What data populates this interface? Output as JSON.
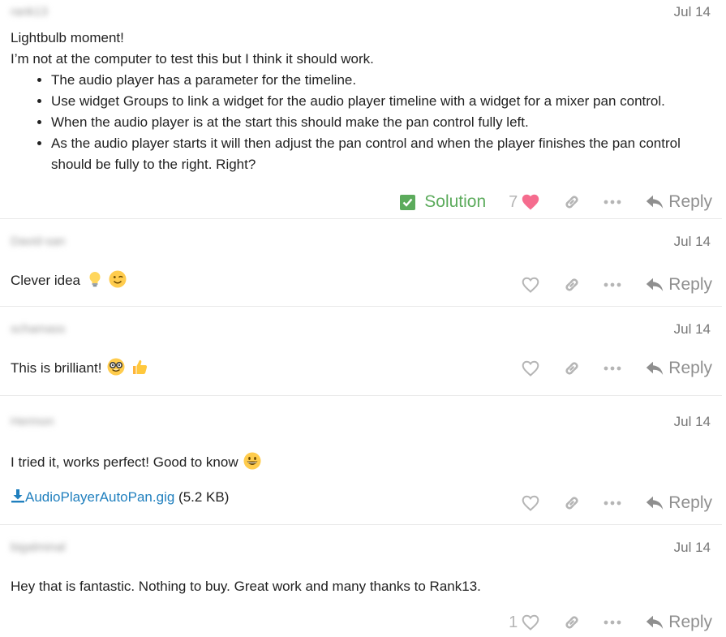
{
  "posts": [
    {
      "author": "rank13",
      "date": "Jul 14",
      "lines": [
        "Lightbulb moment!",
        "I’m not at the computer to test this but I think it should work."
      ],
      "bullets": [
        "The audio player has a parameter for the timeline.",
        "Use widget Groups to link a widget for the audio player timeline with a widget for a mixer pan control.",
        "When the audio player is at the start this should make the pan control fully left.",
        "As the audio player starts it will then adjust the pan control and when the player finishes the pan control should be fully to the right. Right?"
      ],
      "solution_label": "Solution",
      "like_count": "7",
      "reply_label": "Reply"
    },
    {
      "author": "David-san",
      "date": "Jul 14",
      "text": "Clever idea",
      "emojis": [
        "lightbulb",
        "winking-face"
      ],
      "reply_label": "Reply"
    },
    {
      "author": "schamass",
      "date": "Jul 14",
      "text": "This is brilliant!",
      "emojis": [
        "nerd-face",
        "thumbs-up"
      ],
      "reply_label": "Reply"
    },
    {
      "author": "Hermon",
      "date": "Jul 14",
      "text": "I tried it, works perfect! Good to know",
      "emojis": [
        "grinning-face"
      ],
      "attachment": {
        "name": "AudioPlayerAutoPan.gig",
        "size": "(5.2 KB)"
      },
      "reply_label": "Reply"
    },
    {
      "author": "bigalminal",
      "date": "Jul 14",
      "text": "Hey that is fantastic. Nothing to buy. Great work and many thanks to Rank13.",
      "like_count": "1",
      "reply_label": "Reply"
    }
  ],
  "colors": {
    "solution": "#5cab5c",
    "liked_heart": "#f56c8e",
    "link": "#1f7fbe",
    "muted_icon": "#b5b5b5"
  }
}
